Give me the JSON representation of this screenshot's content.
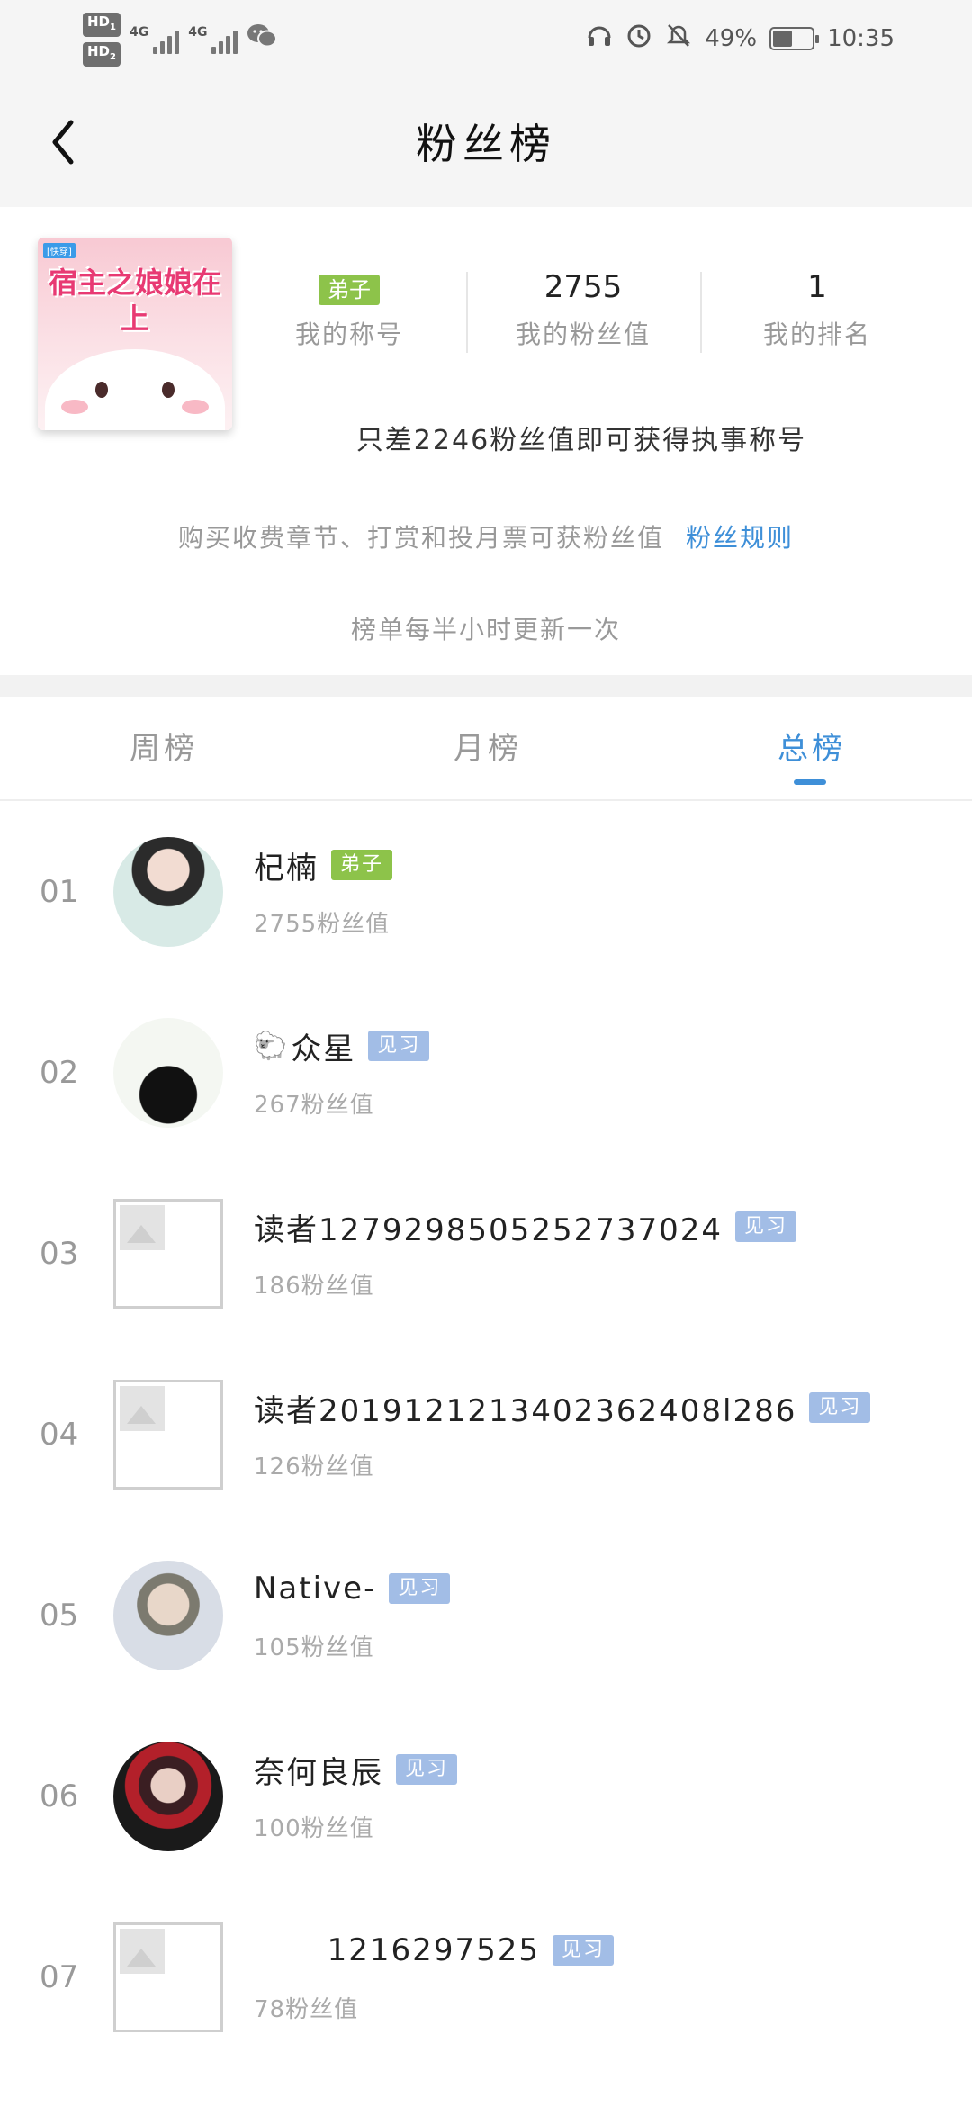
{
  "status_bar": {
    "sim1": "HD",
    "sim2": "HD",
    "net1": "4G",
    "net2": "4G",
    "battery_percent": "49%",
    "battery_level": 0.49,
    "time": "10:35",
    "icons": [
      "headphones-icon",
      "alarm-icon",
      "mute-icon",
      "wechat-icon"
    ]
  },
  "header": {
    "title": "粉丝榜",
    "back_icon": "chevron-left-icon"
  },
  "book": {
    "cover_title": "宿主之娘娘在上",
    "cover_tag": "[快穿]"
  },
  "stats": {
    "title_badge": "弟子",
    "title_label": "我的称号",
    "fan_value": "2755",
    "fan_value_label": "我的粉丝值",
    "rank_value": "1",
    "rank_label": "我的排名"
  },
  "hint": "只差2246粉丝值即可获得执事称号",
  "rules": {
    "text": "购买收费章节、打赏和投月票可获粉丝值",
    "link": "粉丝规则"
  },
  "update_note": "榜单每半小时更新一次",
  "tabs": [
    {
      "label": "周榜",
      "active": false
    },
    {
      "label": "月榜",
      "active": false
    },
    {
      "label": "总榜",
      "active": true
    }
  ],
  "ranking": [
    {
      "rank": "01",
      "name": "杞楠",
      "badge": "弟子",
      "fans": "2755粉丝值"
    },
    {
      "rank": "02",
      "name": "众星",
      "badge": "见习",
      "fans": "267粉丝值"
    },
    {
      "rank": "03",
      "name": "读者1279298505252737024",
      "badge": "见习",
      "fans": "186粉丝值"
    },
    {
      "rank": "04",
      "name": "读者2019121213402362408l286",
      "badge": "见习",
      "fans": "126粉丝值"
    },
    {
      "rank": "05",
      "name": "Native-",
      "badge": "见习",
      "fans": "105粉丝值"
    },
    {
      "rank": "06",
      "name": "奈何良辰",
      "badge": "见习",
      "fans": "100粉丝值"
    },
    {
      "rank": "07",
      "name": "1216297525",
      "badge": "见习",
      "fans": "78粉丝值"
    }
  ],
  "colors": {
    "accent": "#3e8fd8",
    "badge_green": "#8dc34a",
    "badge_blue": "#a2bde6"
  }
}
